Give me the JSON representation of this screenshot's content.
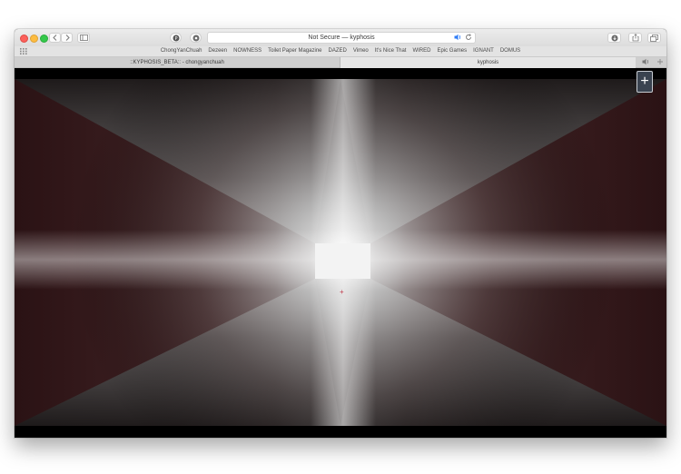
{
  "window": {
    "address_bar": {
      "text": "Not Secure — kyphosis"
    }
  },
  "toolbar_icons": {
    "back": "chevron-left-icon",
    "forward": "chevron-right-icon",
    "sidebar": "sidebar-icon",
    "pinterest": "pinterest-icon",
    "extension": "extension-icon",
    "audio": "speaker-icon",
    "reload": "reload-icon",
    "download": "download-icon",
    "share": "share-icon",
    "tabs": "tabs-icon"
  },
  "bookmarks": [
    "ChongYanChuah",
    "Dezeen",
    "NOWNESS",
    "Toilet Paper Magazine",
    "DAZED",
    "Vimeo",
    "It's Nice That",
    "WIRED",
    "Epic Games",
    "IGNANT",
    "DOMUS"
  ],
  "tabs": [
    {
      "label": "::KYPHOSIS_BETA:: - chongyanchuah"
    },
    {
      "label": "kyphosis"
    }
  ],
  "page": {
    "plus_button": "+",
    "crosshair": "+"
  },
  "colors": {
    "accent_audio": "#2f7cf6",
    "plus_button_bg": "#3a4350",
    "crosshair": "#c0394a"
  }
}
